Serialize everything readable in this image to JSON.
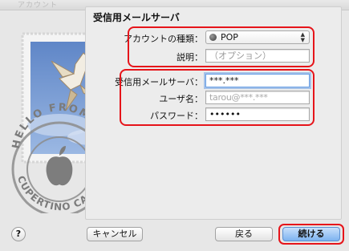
{
  "window": {
    "ghost_title": "アカウント"
  },
  "pane": {
    "title": "受信用メールサーバ"
  },
  "form": {
    "account_type": {
      "label": "アカウントの種類：",
      "value": "POP",
      "icon": "globe-icon"
    },
    "description": {
      "label": "説明：",
      "placeholder": "（オプション）"
    },
    "incoming_server": {
      "label": "受信用メールサーバ：",
      "value": "***.***"
    },
    "username": {
      "label": "ユーザ名：",
      "value": "tarou@***.***"
    },
    "password": {
      "label": "パスワード：",
      "value": "••••••"
    }
  },
  "stamp": {
    "text": "HELLO FROM CUPERTINO CA"
  },
  "buttons": {
    "help": "?",
    "cancel": "キャンセル",
    "back": "戻る",
    "continue": "続ける"
  },
  "colors": {
    "highlight": "#e6141a",
    "accent": "#6aa0e6"
  }
}
